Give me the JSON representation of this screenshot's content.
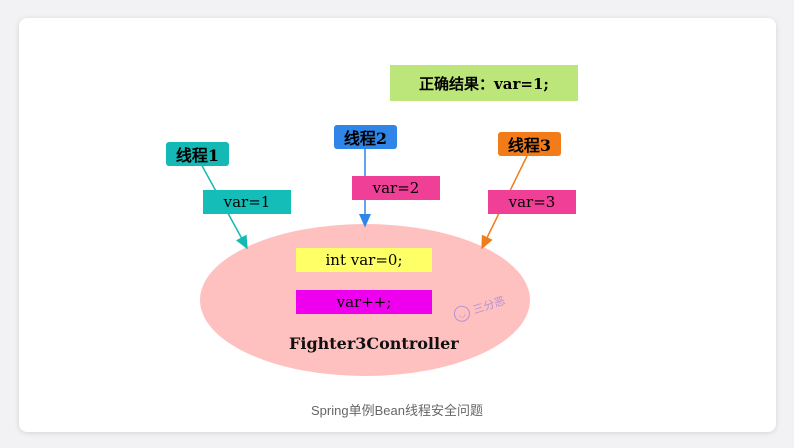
{
  "diagram": {
    "result_label": "正确结果：var=1;",
    "threads": [
      {
        "label": "线程1",
        "var": "var=1",
        "color": "#14b8b5",
        "arrow": "#14b8b5"
      },
      {
        "label": "线程2",
        "var": "var=2",
        "color": "#2f86e8",
        "arrow": "#2f86e8"
      },
      {
        "label": "线程3",
        "var": "var=3",
        "color": "#f27b1a",
        "arrow": "#f27b1a"
      }
    ],
    "var_box_colors": [
      "#15bdb8",
      "#ef3f97",
      "#ef3f97"
    ],
    "code_lines": [
      "int var=0;",
      "var++;"
    ],
    "code_colors": [
      "#ffff66",
      "#ee00ee"
    ],
    "controller_label": "Fighter3Controller",
    "ellipse_color": "#ffc0c0",
    "result_color": "#bde67a",
    "watermark": "三分恶"
  },
  "caption": "Spring单例Bean线程安全问题"
}
